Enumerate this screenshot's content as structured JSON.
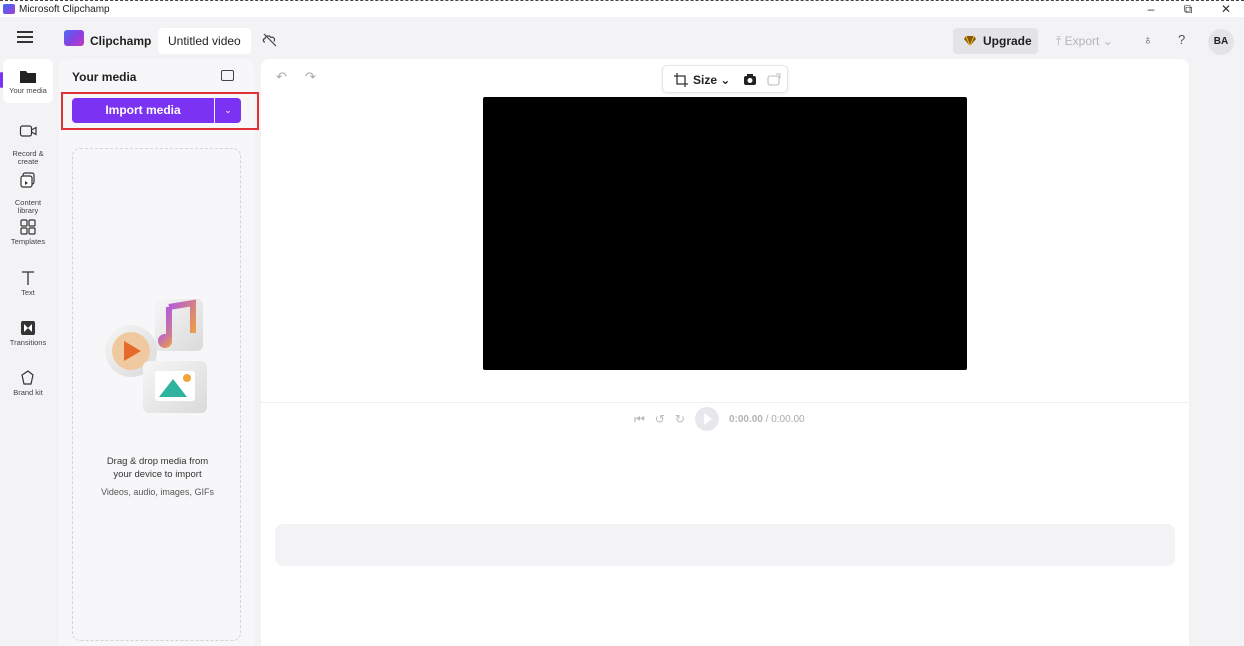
{
  "window": {
    "title": "Microsoft Clipchamp",
    "controls": [
      "–",
      "⧉",
      "✕"
    ]
  },
  "header": {
    "brand": "Clipchamp",
    "video_title": "Untitled video",
    "upgrade_label": "Upgrade",
    "export_label": "Export",
    "export_caret": "⌄",
    "avatar_initials": "BA",
    "help_label": "?"
  },
  "rail": {
    "items": [
      {
        "label": "Your media",
        "icon": "folder-icon"
      },
      {
        "label": "Record &\ncreate",
        "icon": "camera-icon"
      },
      {
        "label": "Content\nlibrary",
        "icon": "library-icon"
      },
      {
        "label": "Templates",
        "icon": "templates-icon"
      },
      {
        "label": "Text",
        "icon": "text-icon"
      },
      {
        "label": "Transitions",
        "icon": "transitions-icon"
      },
      {
        "label": "Brand kit",
        "icon": "brand-kit-icon"
      }
    ]
  },
  "media_panel": {
    "title": "Your media",
    "import_label": "Import media",
    "dropzone_line1": "Drag & drop media from",
    "dropzone_line2": "your device to import",
    "dropzone_sub": "Videos, audio, images, GIFs"
  },
  "stage": {
    "size_label": "Size",
    "size_caret": "⌄",
    "time_current": "0:00.00",
    "time_total": "/ 0:00.00"
  },
  "colors": {
    "accent": "#7b32f3",
    "highlight": "#e03232",
    "canvas": "#000000"
  }
}
